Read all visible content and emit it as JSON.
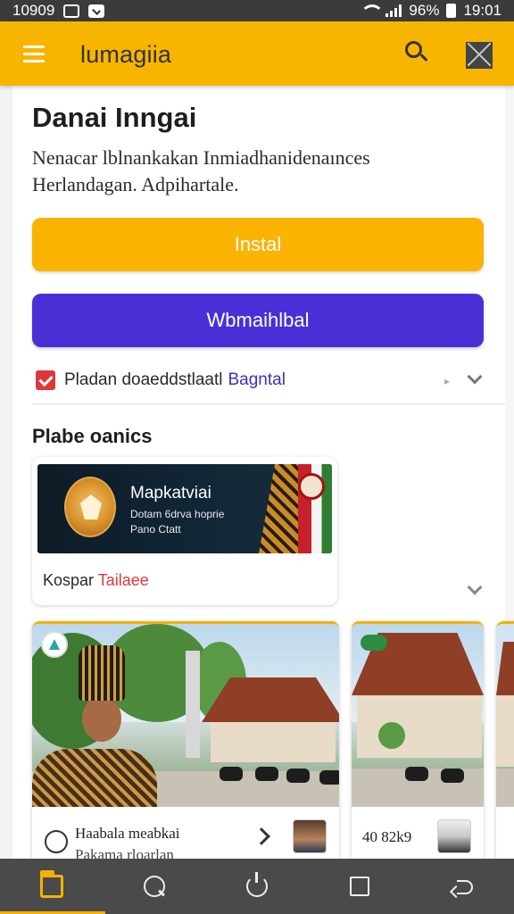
{
  "status_bar": {
    "time_left": "10909",
    "battery": "96%",
    "time_right": "19:01"
  },
  "app_bar": {
    "title": "lumagiia",
    "icons": [
      "menu-icon",
      "search-icon",
      "close-icon"
    ]
  },
  "main": {
    "title": "Danai Inngai",
    "description": "Nenacar lblnankakan Inmiadhanidenaınces Herlandagan. Adpihartale.",
    "primary_button": "Instal",
    "secondary_button": "Wbmaihlbal",
    "checkbox": {
      "label": "Pladan doaeddstlaatl",
      "link": "Bagntal",
      "checked": true
    }
  },
  "section": {
    "title": "Plabe oanics",
    "feature_card": {
      "banner_title": "Mapkatviai",
      "banner_line1": "Dotam 6drva hoprie",
      "banner_line2": "Pano Ctatt",
      "footer_text": "Kospar",
      "footer_accent": "Tailaee"
    },
    "cards": [
      {
        "title": "Haabala meabkai",
        "subtitle": "Pakama rloarlan"
      },
      {
        "title": "40 82k9"
      }
    ]
  },
  "bottom_nav": {
    "items": [
      "home-icon",
      "chat-icon",
      "power-icon",
      "square-icon",
      "back-icon"
    ],
    "active": "home-icon"
  },
  "colors": {
    "app_bar": "#f7b500",
    "primary_button": "#f9b300",
    "secondary_button": "#4b2fd6",
    "link": "#3a2fc0",
    "accent_red": "#d63a3a",
    "nav_bg": "#4a4a4a"
  }
}
